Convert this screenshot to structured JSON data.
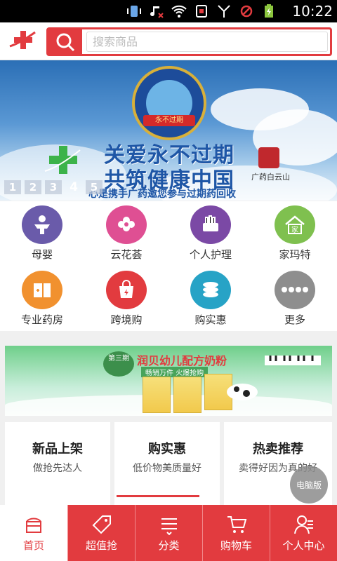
{
  "status_bar": {
    "time": "10:22",
    "icons": [
      "vibrate-icon",
      "music-icon",
      "mute-icon",
      "wifi-icon",
      "sim-icon",
      "signal-icon",
      "block-icon",
      "battery-charging-icon"
    ]
  },
  "header": {
    "logo": "cross-logo",
    "search_placeholder": "搜索商品",
    "search_icon": "search-icon"
  },
  "banner": {
    "line1": "关爱永不过期",
    "line2": "共筑健康中国",
    "line3": "心是携手广药邀您参与过期药回收",
    "badge_text": "永不过期",
    "brand": "广药白云山",
    "pages": [
      "1",
      "2",
      "3",
      "4",
      "5"
    ],
    "active_page": "4"
  },
  "categories": [
    {
      "label": "母婴",
      "icon": "baby-icon",
      "color": "#6a5baa"
    },
    {
      "label": "云花荟",
      "icon": "flower-icon",
      "color": "#df4f93"
    },
    {
      "label": "个人护理",
      "icon": "care-icon",
      "color": "#7b49a5"
    },
    {
      "label": "家玛特",
      "icon": "home-icon",
      "color": "#7fc04f"
    },
    {
      "label": "专业药房",
      "icon": "pharmacy-icon",
      "color": "#f1912f"
    },
    {
      "label": "跨境购",
      "icon": "shopping-bag-icon",
      "color": "#e23b3f"
    },
    {
      "label": "购实惠",
      "icon": "coins-icon",
      "color": "#27a3c6"
    },
    {
      "label": "更多",
      "icon": "more-icon",
      "color": "#8e8e8e"
    }
  ],
  "promo": {
    "title": "润贝幼儿配方奶粉",
    "subtitle": "畅销万件 火爆抢购",
    "tag": "第三期"
  },
  "feature_boxes": [
    {
      "title": "新品上架",
      "subtitle": "做抢先达人"
    },
    {
      "title": "购实惠",
      "subtitle": "低价物美质量好"
    },
    {
      "title": "热卖推荐",
      "subtitle": "卖得好因为真的好"
    }
  ],
  "pc_button": "电脑版",
  "nav": [
    {
      "label": "首页",
      "icon": "home-tab-icon",
      "active": true
    },
    {
      "label": "超值抢",
      "icon": "tag-icon",
      "active": false
    },
    {
      "label": "分类",
      "icon": "list-icon",
      "active": false
    },
    {
      "label": "购物车",
      "icon": "cart-icon",
      "active": false
    },
    {
      "label": "个人中心",
      "icon": "user-icon",
      "active": false
    }
  ]
}
